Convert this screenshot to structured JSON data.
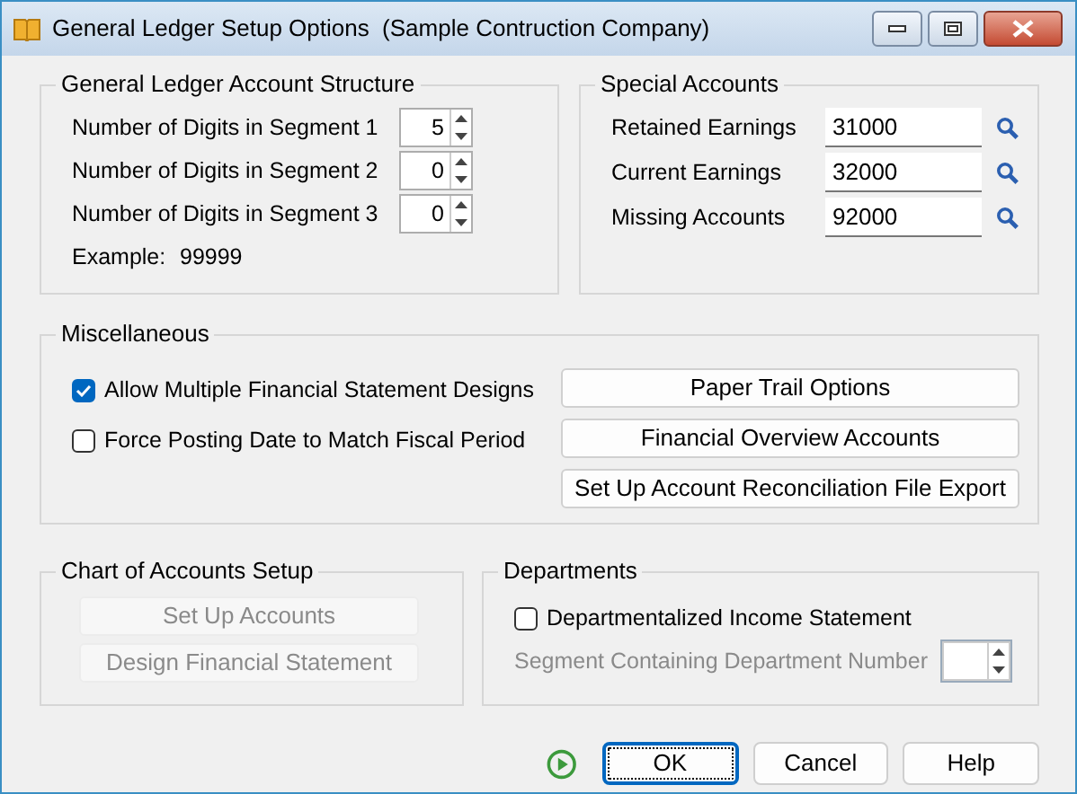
{
  "window": {
    "title": "General Ledger Setup Options  (Sample Contruction Company)"
  },
  "account_structure": {
    "title": "General Ledger Account Structure",
    "segments": [
      {
        "label": "Number of Digits in Segment 1",
        "value": "5"
      },
      {
        "label": "Number of Digits in Segment 2",
        "value": "0"
      },
      {
        "label": "Number of Digits in Segment 3",
        "value": "0"
      }
    ],
    "example_label": "Example:",
    "example_value": "99999"
  },
  "special_accounts": {
    "title": "Special Accounts",
    "accounts": [
      {
        "label": "Retained Earnings",
        "value": "31000"
      },
      {
        "label": "Current Earnings",
        "value": "32000"
      },
      {
        "label": "Missing Accounts",
        "value": "92000"
      }
    ]
  },
  "miscellaneous": {
    "title": "Miscellaneous",
    "checkboxes": [
      {
        "label": "Allow Multiple Financial Statement Designs",
        "checked": true
      },
      {
        "label": "Force Posting Date to Match Fiscal Period",
        "checked": false
      }
    ],
    "buttons": [
      "Paper Trail Options",
      "Financial Overview Accounts",
      "Set Up Account Reconciliation File Export"
    ]
  },
  "chart_of_accounts": {
    "title": "Chart of Accounts Setup",
    "buttons": [
      {
        "label": "Set Up Accounts",
        "disabled": true
      },
      {
        "label": "Design Financial Statement",
        "disabled": true
      }
    ]
  },
  "departments": {
    "title": "Departments",
    "checkbox": {
      "label": "Departmentalized Income Statement",
      "checked": false
    },
    "segment": {
      "label": "Segment Containing Department Number",
      "disabled": true
    }
  },
  "footer_buttons": [
    {
      "label": "OK",
      "selected": true
    },
    {
      "label": "Cancel",
      "selected": false
    },
    {
      "label": "Help",
      "selected": false
    }
  ]
}
